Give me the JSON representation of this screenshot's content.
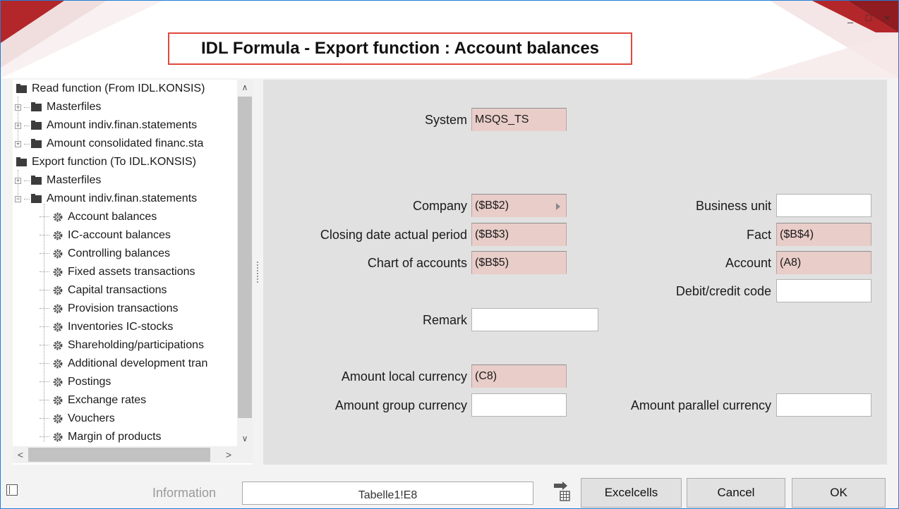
{
  "window": {
    "title": "IDL Formula - Export function : Account balances",
    "controls": {
      "minimize": "_",
      "maximize": "□",
      "close": "×"
    }
  },
  "tree": {
    "items": [
      {
        "label": "Read function (From IDL.KONSIS)",
        "level": 0,
        "type": "folder"
      },
      {
        "label": "Masterfiles",
        "level": 1,
        "type": "folder",
        "expander": "+"
      },
      {
        "label": "Amount indiv.finan.statements",
        "level": 1,
        "type": "folder",
        "expander": "+"
      },
      {
        "label": "Amount consolidated financ.sta",
        "level": 1,
        "type": "folder",
        "expander": "+"
      },
      {
        "label": "Export function (To IDL.KONSIS)",
        "level": 0,
        "type": "folder"
      },
      {
        "label": "Masterfiles",
        "level": 1,
        "type": "folder",
        "expander": "+"
      },
      {
        "label": "Amount indiv.finan.statements",
        "level": 1,
        "type": "folder",
        "expander": "−"
      },
      {
        "label": "Account balances",
        "level": 2,
        "type": "gear",
        "selected": true
      },
      {
        "label": "IC-account balances",
        "level": 2,
        "type": "gear"
      },
      {
        "label": "Controlling balances",
        "level": 2,
        "type": "gear"
      },
      {
        "label": "Fixed assets transactions",
        "level": 2,
        "type": "gear"
      },
      {
        "label": "Capital transactions",
        "level": 2,
        "type": "gear"
      },
      {
        "label": "Provision transactions",
        "level": 2,
        "type": "gear"
      },
      {
        "label": "Inventories IC-stocks",
        "level": 2,
        "type": "gear"
      },
      {
        "label": "Shareholding/participations",
        "level": 2,
        "type": "gear"
      },
      {
        "label": "Additional development tran",
        "level": 2,
        "type": "gear"
      },
      {
        "label": "Postings",
        "level": 2,
        "type": "gear"
      },
      {
        "label": "Exchange rates",
        "level": 2,
        "type": "gear"
      },
      {
        "label": "Vouchers",
        "level": 2,
        "type": "gear"
      },
      {
        "label": "Margin of products",
        "level": 2,
        "type": "gear"
      }
    ],
    "scroll": {
      "up": "∧",
      "down": "∨",
      "left": "<",
      "right": ">"
    }
  },
  "form": {
    "system": {
      "label": "System",
      "value": "MSQS_TS"
    },
    "company": {
      "label": "Company",
      "value": "($B$2)"
    },
    "closing_date": {
      "label": "Closing date actual period",
      "value": "($B$3)"
    },
    "chart_of_accounts": {
      "label": "Chart of accounts",
      "value": "($B$5)"
    },
    "remark": {
      "label": "Remark",
      "value": ""
    },
    "business_unit": {
      "label": "Business unit",
      "value": ""
    },
    "fact": {
      "label": "Fact",
      "value": "($B$4)"
    },
    "account": {
      "label": "Account",
      "value": "(A8)"
    },
    "debit_credit": {
      "label": "Debit/credit code",
      "value": ""
    },
    "amount_local": {
      "label": "Amount local currency",
      "value": "(C8)"
    },
    "amount_group": {
      "label": "Amount group currency",
      "value": ""
    },
    "amount_parallel": {
      "label": "Amount parallel currency",
      "value": ""
    }
  },
  "footer": {
    "info_label": "Information",
    "info_value": "Tabelle1!E8",
    "excelcells_label": "Excelcells",
    "cancel_label": "Cancel",
    "ok_label": "OK"
  },
  "colors": {
    "accent_red": "#b3262a",
    "title_border": "#e0493f",
    "window_border": "#1f7fd6",
    "pink_field": "#e9cdc9",
    "form_bg": "#e1e1e1"
  }
}
